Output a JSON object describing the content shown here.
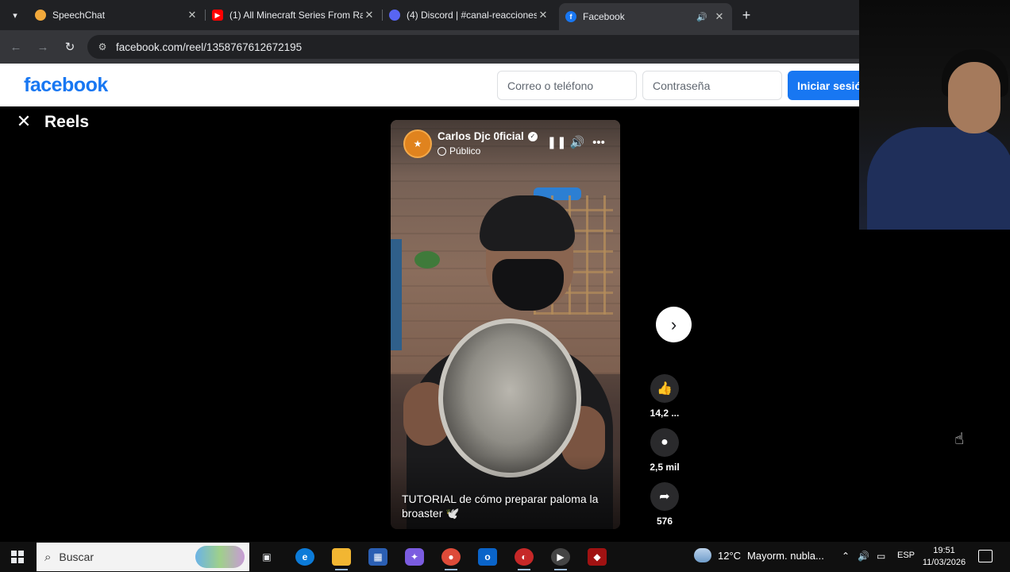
{
  "browser": {
    "tabs": [
      {
        "title": "SpeechChat",
        "favicon": "speechchat-icon",
        "color": "#f2a93b",
        "active": false
      },
      {
        "title": "(1) All Minecraft Series From Ra",
        "favicon": "youtube-icon",
        "color": "#ff0000",
        "active": false
      },
      {
        "title": "(4) Discord | #canal-reacciones",
        "favicon": "discord-icon",
        "color": "#5865f2",
        "active": false
      },
      {
        "title": "Facebook",
        "favicon": "facebook-icon",
        "color": "#1877f2",
        "active": true
      }
    ],
    "url": "facebook.com/reel/1358767612672195"
  },
  "facebook": {
    "logo": "facebook",
    "email_placeholder": "Correo o teléfono",
    "password_placeholder": "Contraseña",
    "login_label": "Iniciar sesión",
    "brand_color": "#1877f2"
  },
  "reels": {
    "title": "Reels",
    "author": "Carlos Djc 0ficial",
    "privacy": "Público",
    "caption": "TUTORIAL de cómo preparar paloma la broaster 🕊️",
    "likes": "14,2 ...",
    "comments": "2,5 mil",
    "shares": "576"
  },
  "taskbar": {
    "search_placeholder": "Buscar",
    "weather_temp": "12°C",
    "weather_desc": "Mayorm. nubla...",
    "language": "ESP",
    "time": "19:51",
    "date": "11/03/2026"
  }
}
